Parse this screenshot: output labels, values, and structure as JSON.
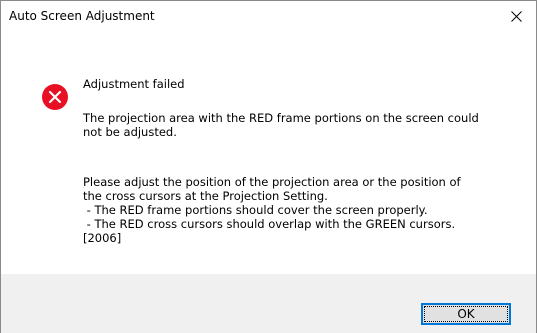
{
  "window": {
    "title": "Auto Screen Adjustment",
    "close_icon": "close-icon"
  },
  "message": {
    "icon": "error-icon",
    "icon_color": "#e81123",
    "heading": "Adjustment failed",
    "line1": "The projection area with the RED frame portions on the screen could",
    "line2": "not be adjusted.",
    "line3": "Please adjust the position of the projection area or the position of",
    "line4": "the cross cursors at the Projection Setting.",
    "line5": " - The RED frame portions should cover the screen properly.",
    "line6": " - The RED cross cursors should overlap with the GREEN cursors.",
    "line7": "[2006]"
  },
  "footer": {
    "ok_label": "OK",
    "accent": "#0078d7"
  }
}
